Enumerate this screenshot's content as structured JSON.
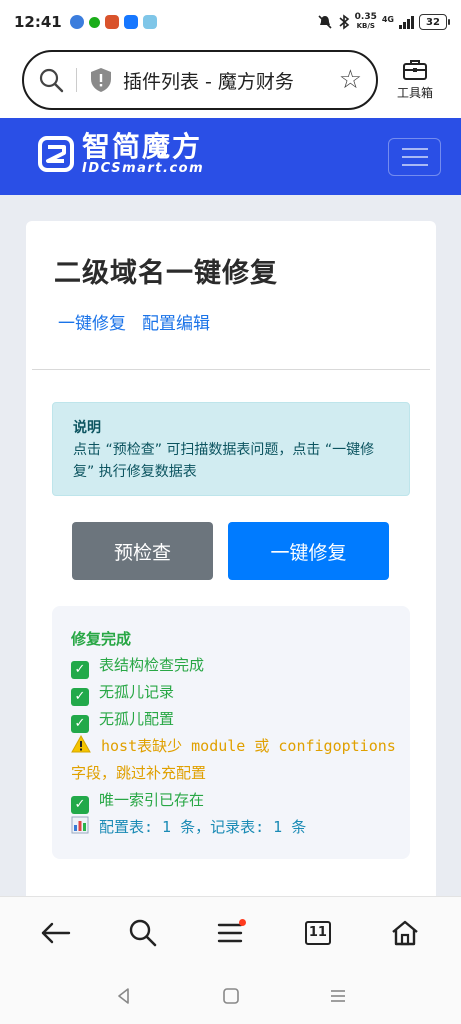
{
  "status_bar": {
    "time": "12:41",
    "net_speed_value": "0.35",
    "net_speed_unit": "KB/S",
    "network": "4G",
    "battery": "32"
  },
  "browser": {
    "page_title": "插件列表 - 魔方财务",
    "toolbox_label": "工具箱",
    "tab_count": "11"
  },
  "site": {
    "logo_cn": "智简魔方",
    "logo_en": "IDCSmart.com"
  },
  "main": {
    "title": "二级域名一键修复",
    "tabs": [
      {
        "label": "一键修复"
      },
      {
        "label": "配置编辑"
      }
    ],
    "notice": {
      "heading": "说明",
      "body": "点击 “预检查” 可扫描数据表问题，点击 “一键修复” 执行修复数据表"
    },
    "buttons": {
      "precheck": "预检查",
      "fix": "一键修复"
    },
    "result": {
      "heading": "修复完成",
      "lines": [
        {
          "status": "ok",
          "text": "表结构检查完成"
        },
        {
          "status": "ok",
          "text": "无孤儿记录"
        },
        {
          "status": "ok",
          "text": "无孤儿配置"
        },
        {
          "status": "warn",
          "text": "host表缺少 module 或 configoptions 字段，跳过补充配置"
        },
        {
          "status": "ok",
          "text": "唯一索引已存在"
        },
        {
          "status": "info",
          "text": "配置表: 1 条，记录表: 1 条"
        }
      ]
    }
  },
  "colors": {
    "header_blue": "#2a4fe6",
    "primary": "#007bff",
    "secondary": "#6c757d",
    "success": "#28a745",
    "warning": "#e0a000",
    "info_bg": "#d1ecf1",
    "info_text": "#0c5460"
  },
  "icons": {
    "status_bar": [
      "mute-icon",
      "bluetooth-icon",
      "signal-icon",
      "battery-icon"
    ],
    "bottom_nav": [
      "back-arrow-icon",
      "search-icon",
      "menu-icon",
      "tabs-icon",
      "home-icon"
    ],
    "system_nav": [
      "back-triangle-icon",
      "home-square-icon",
      "recents-icon"
    ]
  }
}
